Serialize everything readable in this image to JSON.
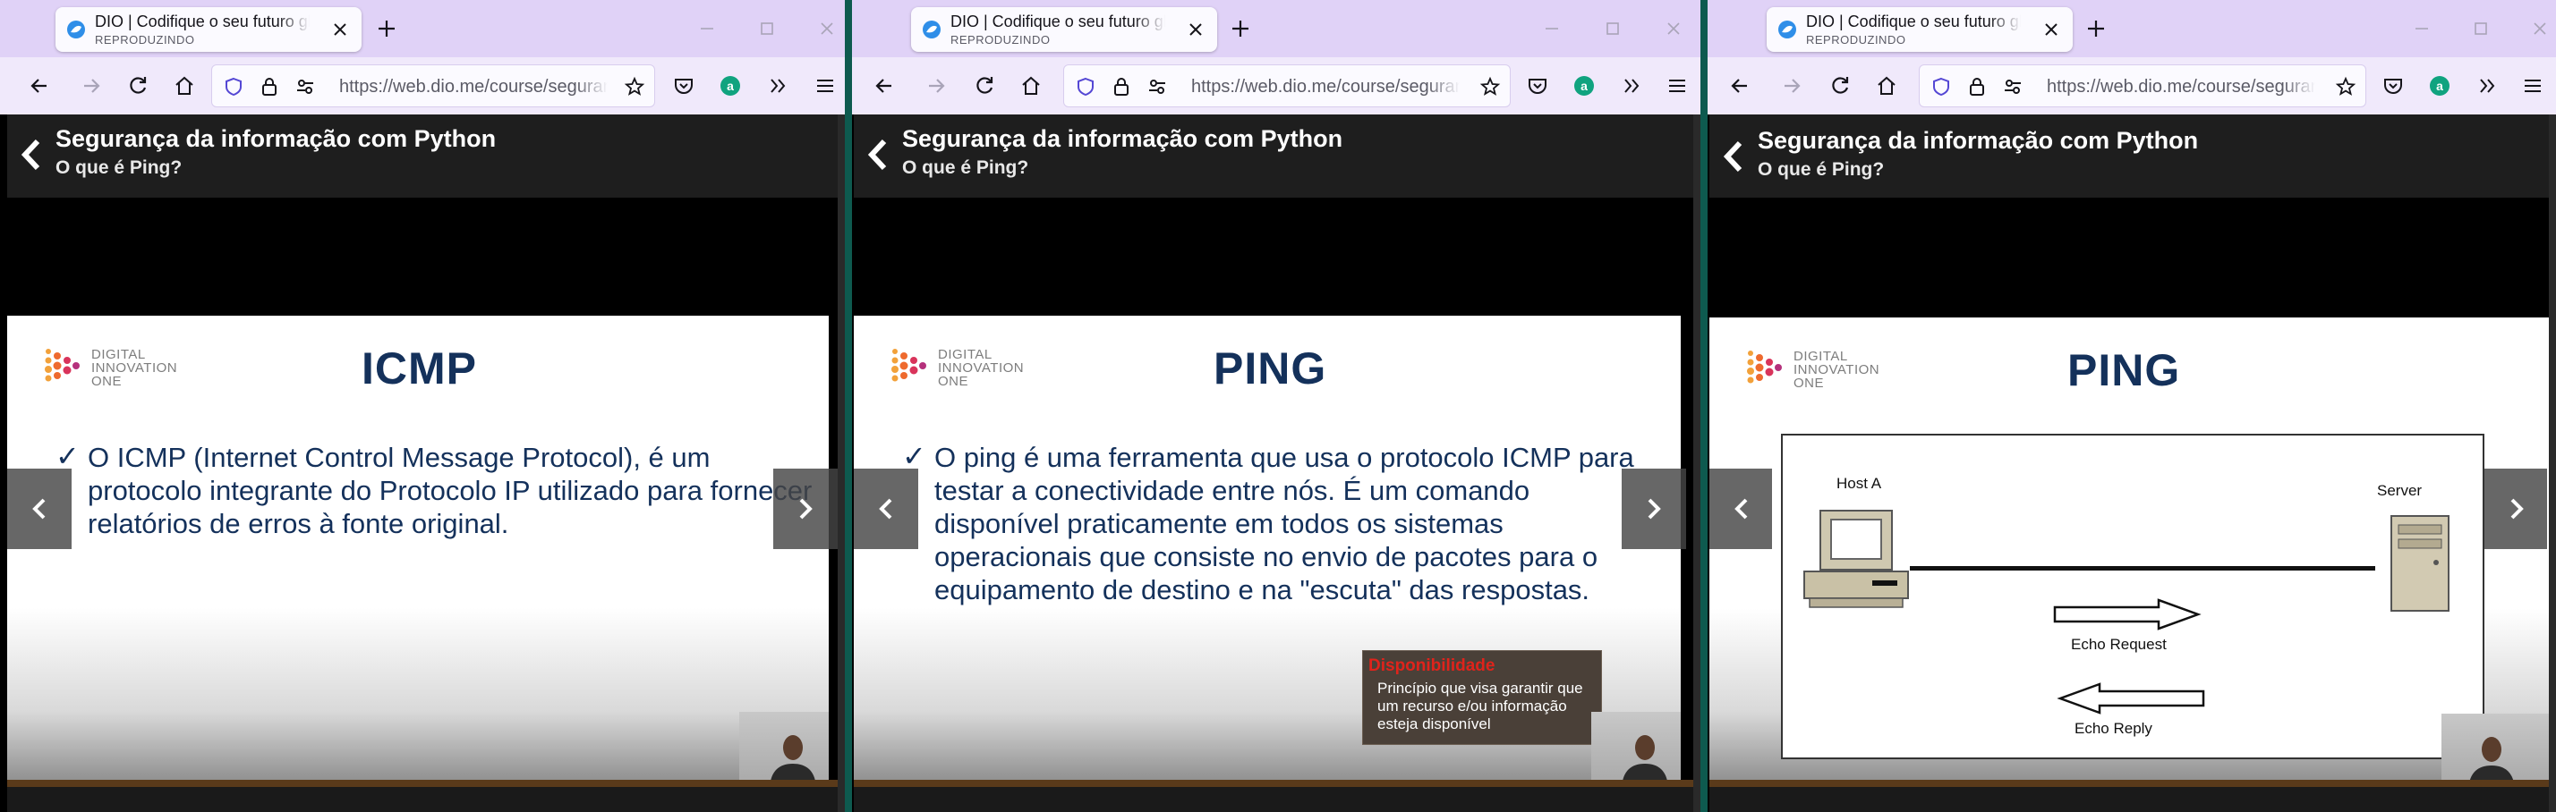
{
  "browser": {
    "tab_title": "DIO | Codifique o seu futuro global",
    "tab_subtitle": "REPRODUZINDO",
    "url": "https://web.dio.me/course/seguranca"
  },
  "course": {
    "title": "Segurança da informação com Python",
    "lesson": "O que é Ping?"
  },
  "logo": {
    "lines": "DIGITAL\nINNOVATION\nONE"
  },
  "windows": [
    {
      "slide_heading": "ICMP",
      "slide_text": "O ICMP (Internet Control Message Protocol), é um protocolo integrante do Protocolo IP utilizado para fornecer relatórios de erros à fonte original."
    },
    {
      "slide_heading": "PING",
      "slide_text": "O ping é uma ferramenta que usa o protocolo ICMP para testar a conectividade entre nós. É um comando disponível praticamente em todos os sistemas operacionais que consiste no envio de pacotes para o equipamento de destino e na \"escuta\" das respostas.",
      "tooltip_title": "Disponibilidade",
      "tooltip_text": "Princípio que visa garantir que um recurso e/ou informação esteja disponível"
    },
    {
      "slide_heading": "PING",
      "diagram": {
        "host_label": "Host A",
        "server_label": "Server",
        "request_label": "Echo Request",
        "reply_label": "Echo Reply"
      }
    }
  ],
  "colors": {
    "titlebar": "#e0d2f7",
    "heading": "#14315b",
    "tooltip_title": "#e0231b"
  }
}
